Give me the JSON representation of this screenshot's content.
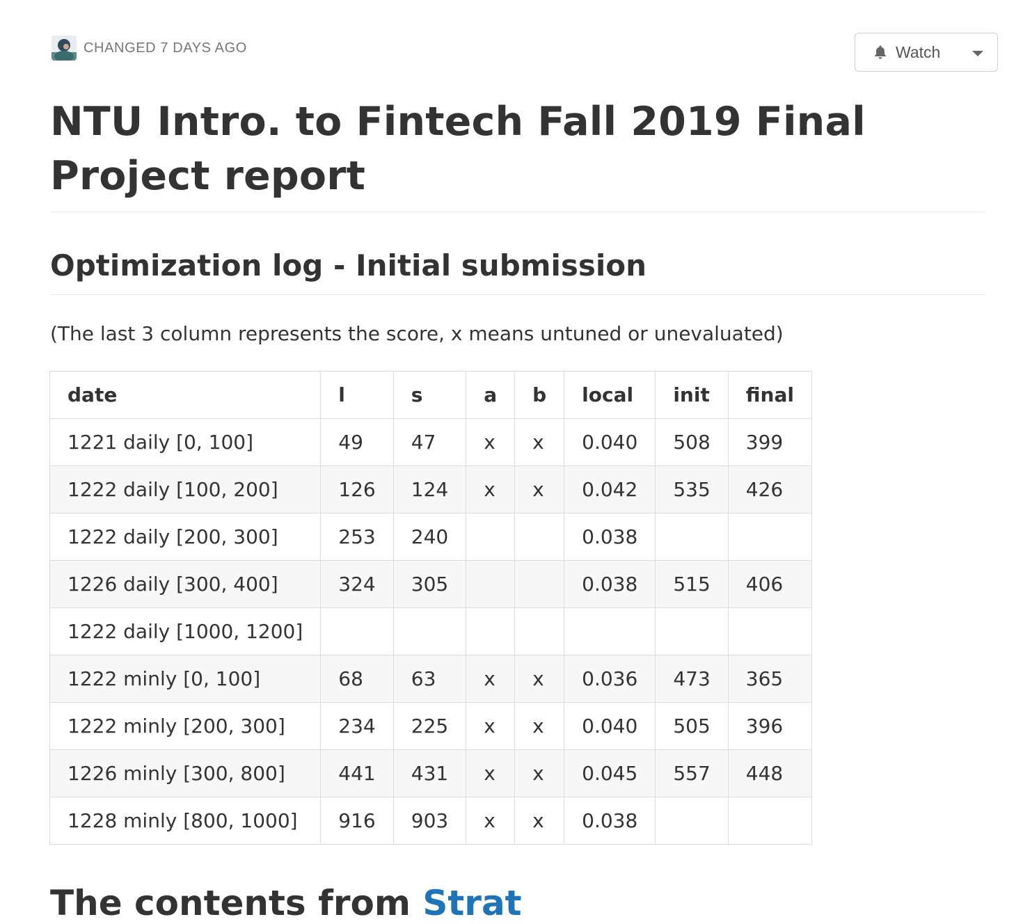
{
  "meta": {
    "changed_text": "CHANGED 7 DAYS AGO"
  },
  "toolbar": {
    "watch_label": "Watch",
    "watch_icon": "bell-icon",
    "dropdown_icon": "caret-down-icon"
  },
  "title": "NTU Intro. to Fintech Fall 2019 Final Project report",
  "section": {
    "heading": "Optimization log - Initial submission",
    "note": "(The last 3 column represents the score, x means untuned or unevaluated)"
  },
  "table": {
    "headers": [
      "date",
      "l",
      "s",
      "a",
      "b",
      "local",
      "init",
      "final"
    ],
    "rows": [
      [
        "1221 daily [0, 100]",
        "49",
        "47",
        "x",
        "x",
        "0.040",
        "508",
        "399"
      ],
      [
        "1222 daily [100, 200]",
        "126",
        "124",
        "x",
        "x",
        "0.042",
        "535",
        "426"
      ],
      [
        "1222 daily [200, 300]",
        "253",
        "240",
        "",
        "",
        "0.038",
        "",
        ""
      ],
      [
        "1226 daily [300, 400]",
        "324",
        "305",
        "",
        "",
        "0.038",
        "515",
        "406"
      ],
      [
        "1222 daily [1000, 1200]",
        "",
        "",
        "",
        "",
        "",
        "",
        ""
      ],
      [
        "1222 minly [0, 100]",
        "68",
        "63",
        "x",
        "x",
        "0.036",
        "473",
        "365"
      ],
      [
        "1222 minly [200, 300]",
        "234",
        "225",
        "x",
        "x",
        "0.040",
        "505",
        "396"
      ],
      [
        "1226 minly [300, 800]",
        "441",
        "431",
        "x",
        "x",
        "0.045",
        "557",
        "448"
      ],
      [
        "1228 minly [800, 1000]",
        "916",
        "903",
        "x",
        "x",
        "0.038",
        "",
        ""
      ]
    ]
  },
  "next_section": {
    "heading_prefix": "The contents from",
    "heading_link": "Strat"
  }
}
